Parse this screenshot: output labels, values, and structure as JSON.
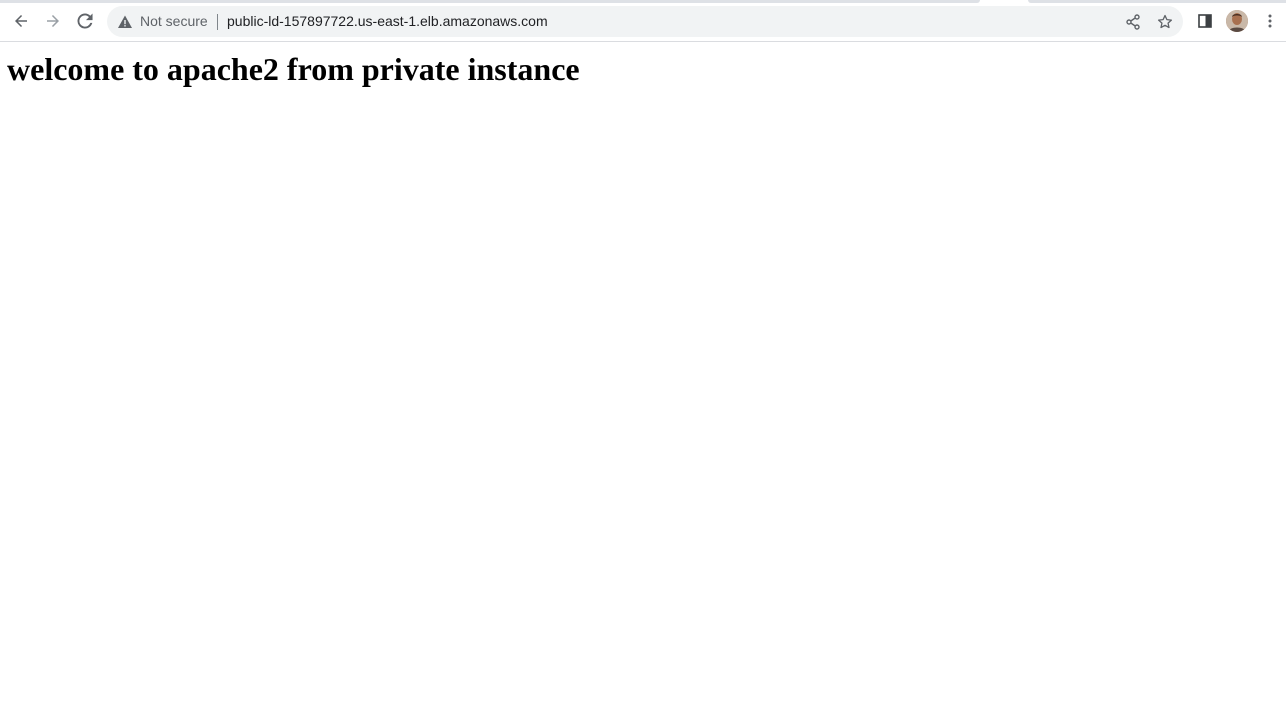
{
  "browser": {
    "security_label": "Not secure",
    "url": "public-ld-157897722.us-east-1.elb.amazonaws.com",
    "icons": {
      "back": "back-arrow-icon",
      "forward": "forward-arrow-icon",
      "reload": "reload-icon",
      "warning": "warning-icon",
      "share": "share-icon",
      "bookmark": "star-icon",
      "side_panel": "side-panel-icon",
      "profile": "profile-avatar",
      "menu": "kebab-menu-icon"
    },
    "colors": {
      "toolbar_bg": "#ffffff",
      "omnibox_bg": "#f1f3f4",
      "icon": "#5f6368",
      "text": "#202124"
    }
  },
  "page": {
    "heading": "welcome to apache2 from private instance"
  }
}
